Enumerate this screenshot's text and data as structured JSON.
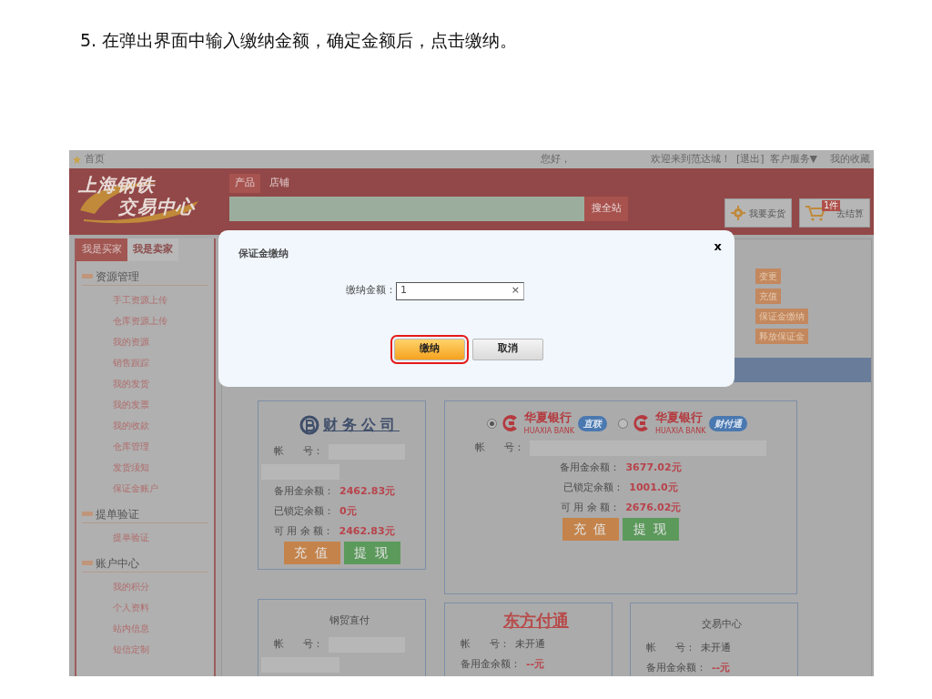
{
  "instruction": "5. 在弹出界面中输入缴纳金额，确定金额后，点击缴纳。",
  "top_bar": {
    "home": "首页",
    "greeting": "您好，",
    "links": [
      "欢迎来到范达城！",
      "[退出]",
      "客户服务▼",
      "我的收藏"
    ]
  },
  "header": {
    "logo": [
      "上海钢铁",
      "交易中心"
    ],
    "search_tabs": [
      {
        "label": "产品",
        "selected": true
      },
      {
        "label": "店铺",
        "selected": false
      }
    ],
    "search_button": "搜全站",
    "sell_button": "我要卖货",
    "cart": {
      "badge": "1件",
      "label": "去结算"
    }
  },
  "sidebar": {
    "tabs": [
      {
        "label": "我是买家",
        "selected": false
      },
      {
        "label": "我是卖家",
        "selected": true
      }
    ],
    "sections": [
      {
        "title": "资源管理",
        "items": [
          "手工资源上传",
          "仓库资源上传",
          "我的资源",
          "销售跟踪",
          "我的发货",
          "我的发票",
          "我的收款",
          "仓库管理",
          "发货须知",
          "保证金账户"
        ]
      },
      {
        "title": "提单验证",
        "items": [
          "提单验证"
        ]
      },
      {
        "title": "账户中心",
        "items": [
          "我的积分",
          "个人资料",
          "站内信息",
          "短信定制"
        ]
      }
    ]
  },
  "actions": [
    "变更",
    "充值",
    "保证金缴纳",
    "释放保证金"
  ],
  "accounts": [
    {
      "kind": "finance-logo",
      "heading": "财务公司",
      "rows": [
        {
          "kind": "redacted",
          "label": "帐      号："
        },
        {
          "kind": "redacted"
        },
        {
          "kind": "amount",
          "label": "备用金余额：",
          "value": "2462.83元"
        },
        {
          "kind": "amount",
          "label": "已锁定余额：",
          "value": "0元"
        },
        {
          "kind": "amount",
          "label": "可 用 余 额：",
          "value": "2462.83元"
        }
      ],
      "buttons": [
        {
          "label": "充 值",
          "color": "#c4834a"
        },
        {
          "label": "提 现",
          "color": "#5c9a5c"
        }
      ]
    },
    {
      "kind": "banks",
      "banks": [
        {
          "name": "华夏银行",
          "latin": "HUAXIA  BANK",
          "tag": "直联",
          "selected": true
        },
        {
          "name": "华夏银行",
          "latin": "HUAXIA  BANK",
          "tag": "财付通",
          "selected": false
        }
      ],
      "rows": [
        {
          "kind": "redacted",
          "label": "帐      号："
        },
        {
          "kind": "amount",
          "label": "备用金余额：",
          "value": "3677.02元"
        },
        {
          "kind": "amount",
          "label": "已锁定余额：",
          "value": "1001.0元"
        },
        {
          "kind": "amount",
          "label": "可 用 余 额：",
          "value": "2676.02元"
        }
      ],
      "buttons": [
        {
          "label": "充 值",
          "color": "#c4834a"
        },
        {
          "label": "提 现",
          "color": "#5c9a5c"
        }
      ]
    },
    {
      "kind": "title",
      "heading": "钢贸直付",
      "rows": [
        {
          "kind": "redacted",
          "label": "帐      号："
        },
        {
          "kind": "redacted"
        }
      ]
    },
    {
      "kind": "brand",
      "heading": "东方付通",
      "rows": [
        {
          "kind": "text",
          "label": "帐      号：",
          "value": "未开通"
        },
        {
          "kind": "amount",
          "label": "备用金余额：",
          "value": "--元"
        }
      ]
    },
    {
      "kind": "title",
      "heading": "交易中心",
      "rows": [
        {
          "kind": "text",
          "label": "帐      号：",
          "value": "未开通"
        },
        {
          "kind": "amount",
          "label": "备用金余额：",
          "value": "--元"
        }
      ]
    }
  ],
  "dialog": {
    "title": "保证金缴纳",
    "close": "x",
    "field": {
      "label": "缴纳金额：",
      "value": "1",
      "clear": "×"
    },
    "buttons": [
      {
        "label": "缴纳",
        "kind": "primary",
        "highlighted": true
      },
      {
        "label": "取消",
        "kind": "secondary",
        "highlighted": false
      }
    ]
  }
}
